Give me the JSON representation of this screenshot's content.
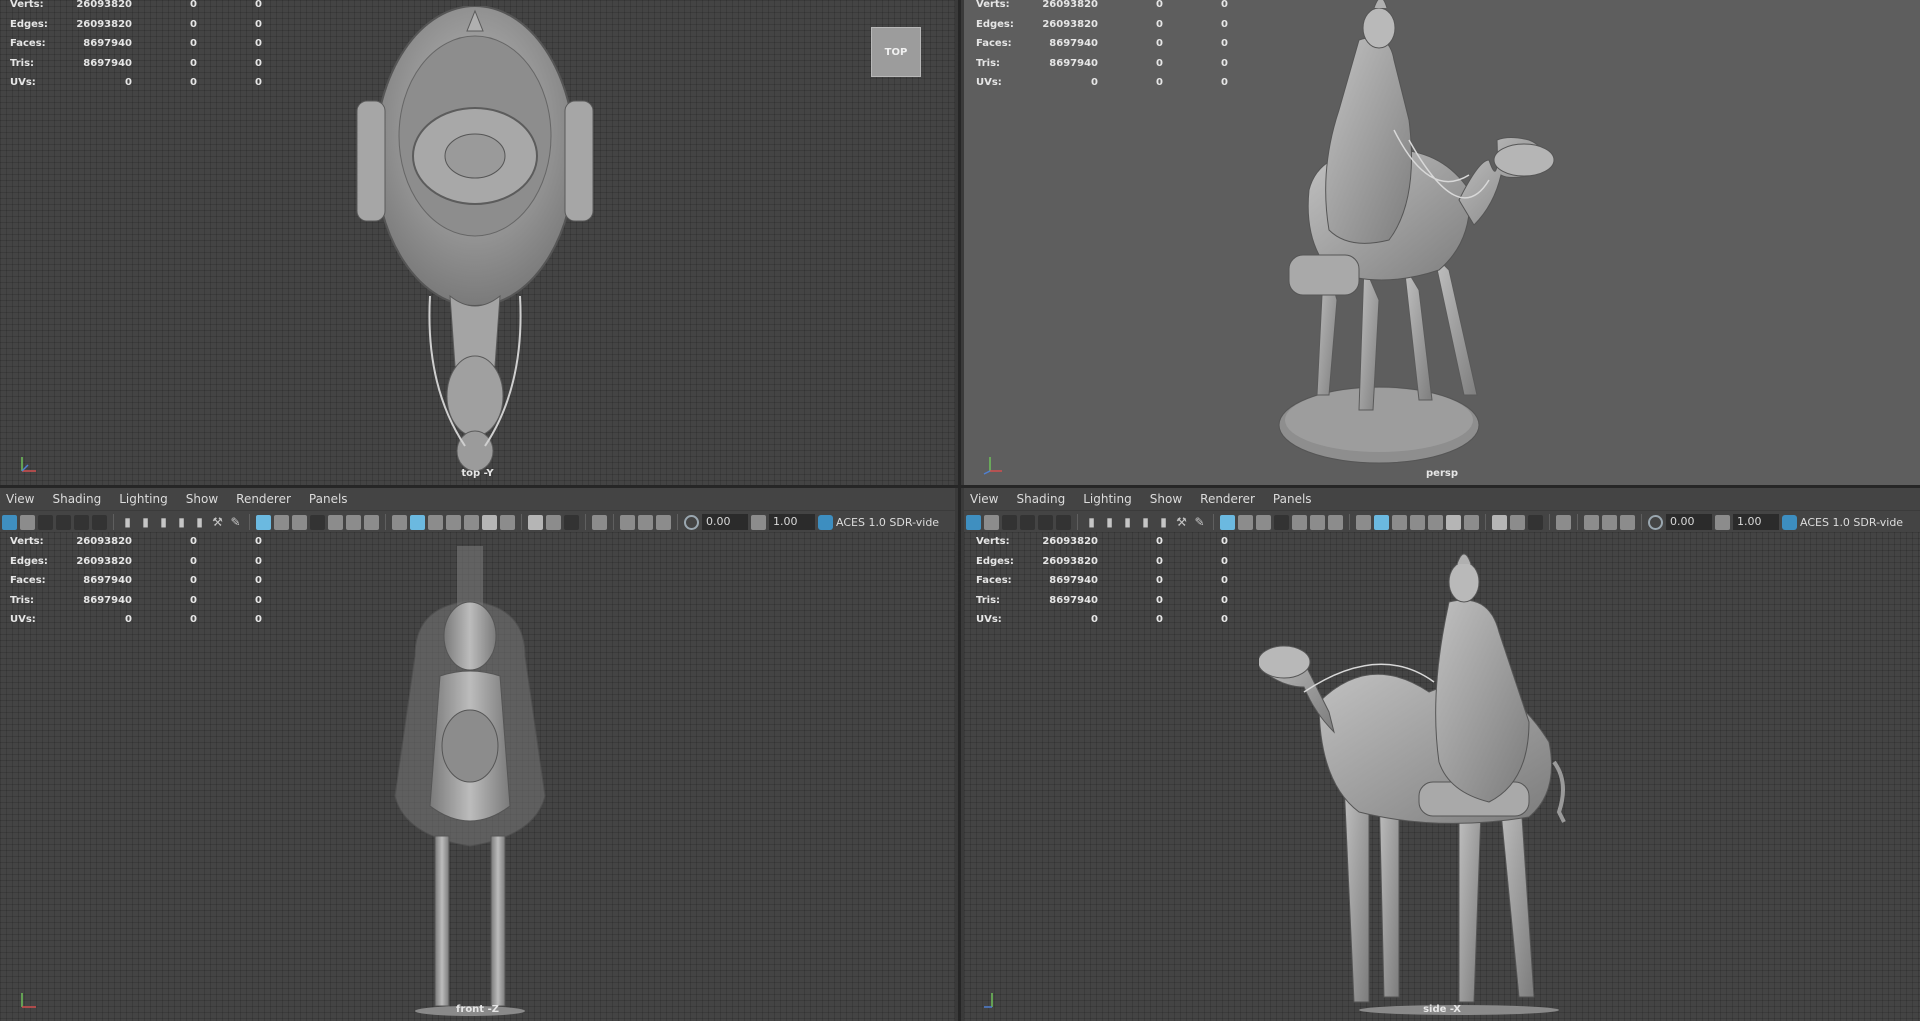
{
  "stats": {
    "rows": [
      {
        "label": "Verts:",
        "v1": "26093820",
        "v2": "0",
        "v3": "0"
      },
      {
        "label": "Edges:",
        "v1": "26093820",
        "v2": "0",
        "v3": "0"
      },
      {
        "label": "Faces:",
        "v1": "8697940",
        "v2": "0",
        "v3": "0"
      },
      {
        "label": "Tris:",
        "v1": "8697940",
        "v2": "0",
        "v3": "0"
      },
      {
        "label": "UVs:",
        "v1": "0",
        "v2": "0",
        "v3": "0"
      }
    ]
  },
  "viewports": {
    "top": {
      "camera": "top -Y",
      "viewcube": "TOP"
    },
    "persp": {
      "camera": "persp"
    },
    "front": {
      "camera": "front -Z"
    },
    "side": {
      "camera": "side -X"
    }
  },
  "panel_menu": [
    "View",
    "Shading",
    "Lighting",
    "Show",
    "Renderer",
    "Panels"
  ],
  "toolbar": {
    "exposure": "0.00",
    "gamma": "1.00",
    "color_space": "ACES 1.0 SDR-vide"
  },
  "axis_labels": {
    "y": "y",
    "z": "z",
    "x": "x"
  }
}
